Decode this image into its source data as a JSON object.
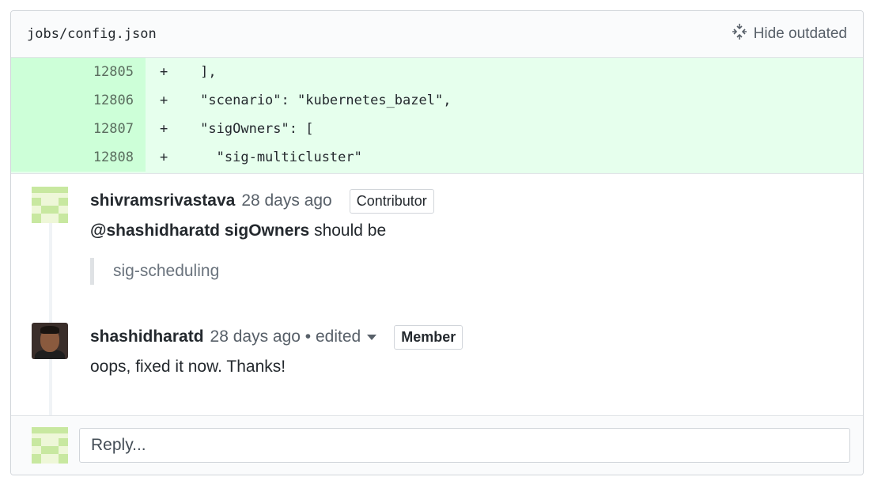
{
  "file": {
    "path": "jobs/config.json",
    "hide_outdated": "Hide outdated"
  },
  "diff": [
    {
      "line": "12805",
      "code": "+    ],"
    },
    {
      "line": "12806",
      "code": "+    \"scenario\": \"kubernetes_bazel\","
    },
    {
      "line": "12807",
      "code": "+    \"sigOwners\": ["
    },
    {
      "line": "12808",
      "code": "+      \"sig-multicluster\""
    }
  ],
  "comments": [
    {
      "author": "shivramsrivastava",
      "time": "28 days ago",
      "badge": "Contributor",
      "mention": "@shashidharatd",
      "keyword": "sigOwners",
      "text": "should be",
      "quote": "sig-scheduling"
    },
    {
      "author": "shashidharatd",
      "time": "28 days ago • edited",
      "badge": "Member",
      "text": "oops, fixed it now. Thanks!"
    }
  ],
  "reply": {
    "placeholder": "Reply..."
  },
  "colors": {
    "diff_bg": "#e6ffed",
    "line_num_bg": "#cdffd8",
    "identicon": "#c8e8a0"
  }
}
